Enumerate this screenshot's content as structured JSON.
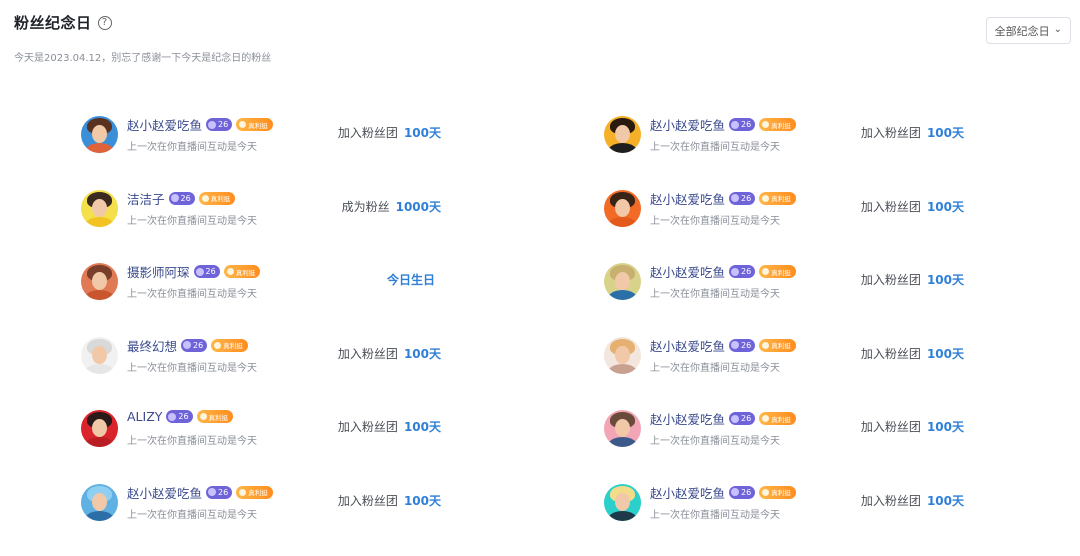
{
  "header": {
    "title": "粉丝纪念日",
    "help_icon": "question-circle-icon",
    "subtitle": "今天是2023.04.12，别忘了感谢一下今天是纪念日的粉丝"
  },
  "filter": {
    "label": "全部纪念日",
    "icon": "chevron-down-icon"
  },
  "colors": {
    "accent": "#2f7fd6",
    "name": "#3a4a8c",
    "level_badge": "#6f63d9",
    "tag_badge": "#ff8c1e"
  },
  "fans_left": [
    {
      "name": "赵小赵爱吃鱼",
      "level": "26",
      "tag": "真利挺",
      "desc": "上一次在你直播间互动是今天",
      "status_label": "加入粉丝团",
      "status_value": "100天"
    },
    {
      "name": "洁洁子",
      "level": "26",
      "tag": "真利挺",
      "desc": "上一次在你直播间互动是今天",
      "status_label": "成为粉丝",
      "status_value": "1000天"
    },
    {
      "name": "摄影师阿琛",
      "level": "26",
      "tag": "真利挺",
      "desc": "上一次在你直播间互动是今天",
      "status_label": "今日生日",
      "status_value": ""
    },
    {
      "name": "最终幻想",
      "level": "26",
      "tag": "真利挺",
      "desc": "上一次在你直播间互动是今天",
      "status_label": "加入粉丝团",
      "status_value": "100天"
    },
    {
      "name": "ALIZY",
      "level": "26",
      "tag": "真利挺",
      "desc": "上一次在你直播间互动是今天",
      "status_label": "加入粉丝团",
      "status_value": "100天"
    },
    {
      "name": "赵小赵爱吃鱼",
      "level": "26",
      "tag": "真利挺",
      "desc": "上一次在你直播间互动是今天",
      "status_label": "加入粉丝团",
      "status_value": "100天"
    }
  ],
  "fans_right": [
    {
      "name": "赵小赵爱吃鱼",
      "level": "26",
      "tag": "真利挺",
      "desc": "上一次在你直播间互动是今天",
      "status_label": "加入粉丝团",
      "status_value": "100天"
    },
    {
      "name": "赵小赵爱吃鱼",
      "level": "26",
      "tag": "真利挺",
      "desc": "上一次在你直播间互动是今天",
      "status_label": "加入粉丝团",
      "status_value": "100天"
    },
    {
      "name": "赵小赵爱吃鱼",
      "level": "26",
      "tag": "真利挺",
      "desc": "上一次在你直播间互动是今天",
      "status_label": "加入粉丝团",
      "status_value": "100天"
    },
    {
      "name": "赵小赵爱吃鱼",
      "level": "26",
      "tag": "真利挺",
      "desc": "上一次在你直播间互动是今天",
      "status_label": "加入粉丝团",
      "status_value": "100天"
    },
    {
      "name": "赵小赵爱吃鱼",
      "level": "26",
      "tag": "真利挺",
      "desc": "上一次在你直播间互动是今天",
      "status_label": "加入粉丝团",
      "status_value": "100天"
    },
    {
      "name": "赵小赵爱吃鱼",
      "level": "26",
      "tag": "真利挺",
      "desc": "上一次在你直播间互动是今天",
      "status_label": "加入粉丝团",
      "status_value": "100天"
    }
  ]
}
